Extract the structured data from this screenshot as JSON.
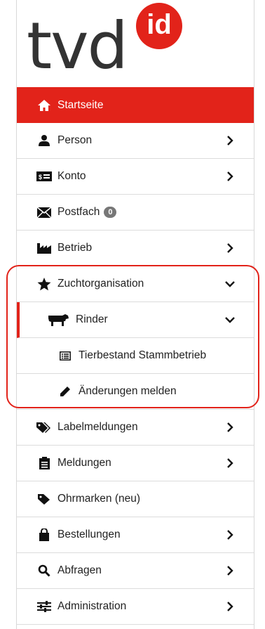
{
  "logo": {
    "text": "tvd",
    "badge": "id",
    "brand_color": "#e2231a"
  },
  "menu": {
    "startseite": "Startseite",
    "person": "Person",
    "konto": "Konto",
    "postfach": "Postfach",
    "postfach_count": "0",
    "betrieb": "Betrieb",
    "zuchtorganisation": "Zuchtorganisation",
    "rinder": "Rinder",
    "tierbestand": "Tierbestand Stammbetrieb",
    "aenderungen": "Änderungen melden",
    "labelmeldungen": "Labelmeldungen",
    "meldungen": "Meldungen",
    "ohrmarken": "Ohrmarken (neu)",
    "bestellungen": "Bestellungen",
    "abfragen": "Abfragen",
    "administration": "Administration"
  }
}
